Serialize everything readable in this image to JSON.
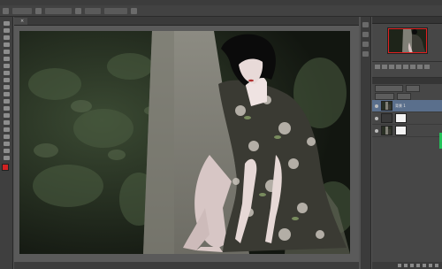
{
  "document": {
    "tab_label": "",
    "zoom": ""
  },
  "statusbar": {
    "zoom_text": "",
    "doc_text": ""
  },
  "panels": {
    "navigator_label": "",
    "layers_label": "",
    "layer_name_selected": "背景 1"
  },
  "colors": {
    "app_bg": "#535353",
    "panel_bg": "#474747",
    "selection": "#5a6f8c",
    "foreground_swatch": "#d22222",
    "background_swatch": "#ffffff"
  },
  "icons": [
    "move-tool-icon",
    "marquee-tool-icon",
    "lasso-tool-icon",
    "quick-select-tool-icon",
    "crop-tool-icon",
    "eyedropper-tool-icon",
    "healing-brush-icon",
    "brush-tool-icon",
    "clone-stamp-icon",
    "history-brush-icon",
    "eraser-tool-icon",
    "gradient-tool-icon",
    "blur-tool-icon",
    "dodge-tool-icon",
    "pen-tool-icon",
    "type-tool-icon",
    "path-select-icon",
    "shape-tool-icon",
    "hand-tool-icon",
    "zoom-tool-icon"
  ]
}
